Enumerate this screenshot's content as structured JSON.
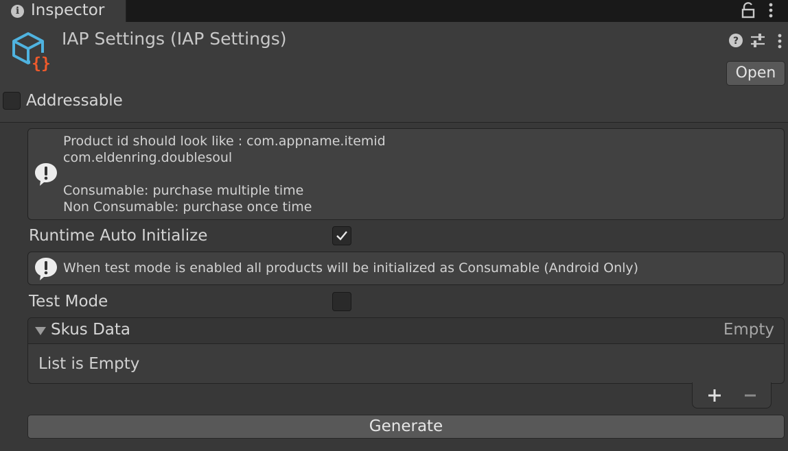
{
  "tab": {
    "icon": "info-icon",
    "icon_glyph": "i",
    "label": "Inspector"
  },
  "header": {
    "asset_icon": "scriptable-object-icon",
    "title": "IAP Settings (IAP Settings)",
    "open_label": "Open",
    "addressable_label": "Addressable",
    "addressable_checked": false
  },
  "help_box_1": {
    "icon": "warning-bubble-icon",
    "lines": [
      "Product id should look like : com.appname.itemid",
      "com.eldenring.doublesoul",
      "",
      "Consumable: purchase multiple time",
      "Non Consumable: purchase once time"
    ]
  },
  "fields": {
    "runtime_auto_initialize": {
      "label": "Runtime Auto Initialize",
      "checked": true
    },
    "test_mode": {
      "label": "Test Mode",
      "checked": false
    }
  },
  "help_box_2": {
    "icon": "warning-bubble-icon",
    "text": "When test mode is enabled all products will be initialized as Consumable (Android Only)"
  },
  "skus_list": {
    "title": "Skus Data",
    "count_label": "Empty",
    "empty_text": "List is Empty",
    "add_icon": "plus-icon",
    "remove_icon": "minus-icon"
  },
  "generate_label": "Generate",
  "colors": {
    "background": "#383838",
    "header": "#3c3c3c",
    "button": "#585858",
    "accent_blue": "#4fb3e0",
    "accent_orange": "#f15a2b"
  }
}
